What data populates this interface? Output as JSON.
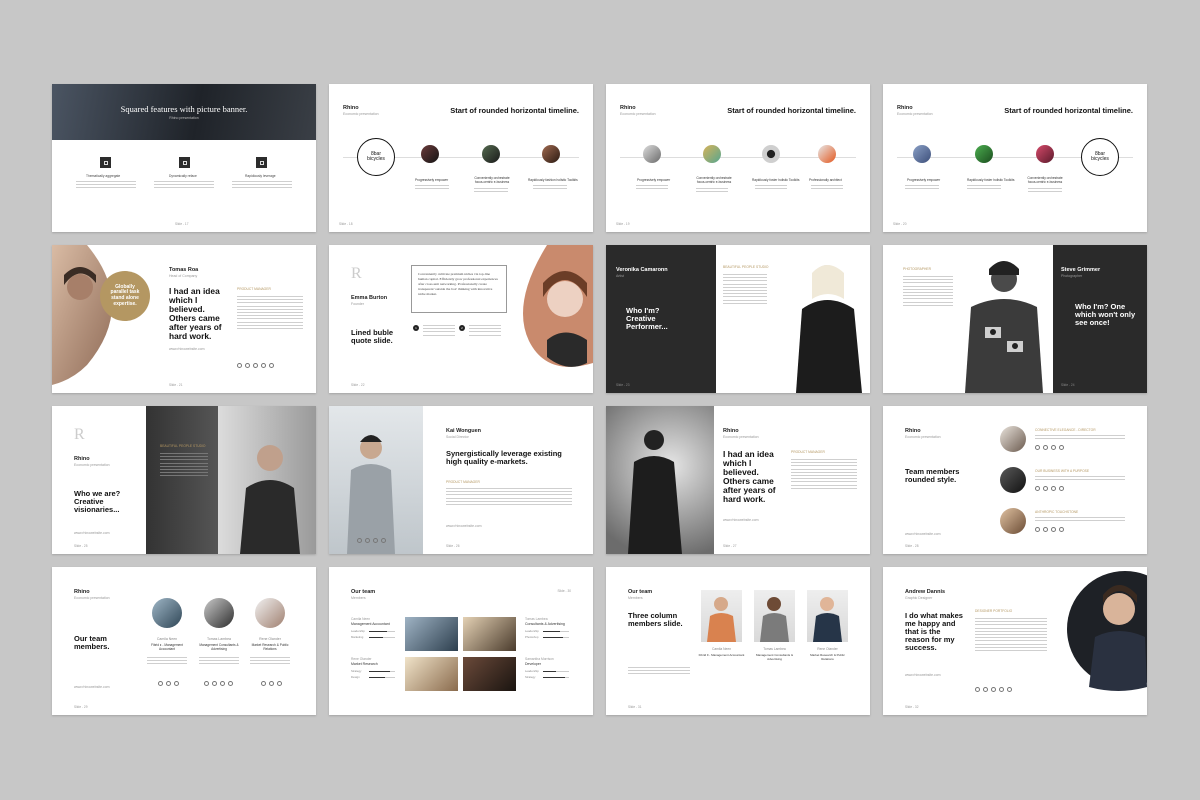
{
  "colors": {
    "accent": "#b49762",
    "dark": "#2a2a2a",
    "background": "#c7c7c7"
  },
  "s1": {
    "title": "Squared features with picture banner.",
    "subtitle": "Rhino presentation",
    "f1": "Thematically aggregate",
    "f2": "Dynamically reface",
    "f3": "Rapidiously leverage",
    "slide": "Slide - 17"
  },
  "s2": {
    "brand": "Rhino",
    "sub": "Economic presentation",
    "title": "Start of rounded horizontal timeline.",
    "ring": "8bar bicycles",
    "l1": "Progressively empower",
    "l2": "Conveniently orchestrate focus-centric e-business",
    "l3": "Rapidiously fashion holistic Toolkits",
    "slide": "Slide - 18"
  },
  "s3": {
    "brand": "Rhino",
    "sub": "Economic presentation",
    "title": "Start of rounded horizontal timeline.",
    "l1": "Progressively empower",
    "l2": "Conveniently orchestrate focus-centric e-business",
    "l3": "Rapidiously foster holistic Toolkits",
    "l4": "Professionally architect",
    "slide": "Slide - 19"
  },
  "s4": {
    "brand": "Rhino",
    "sub": "Economic presentation",
    "title": "Start of rounded horizontal timeline.",
    "ring": "8bar bicycles",
    "l1": "Progressively empower",
    "l2": "Rapidiously foster holistic Toolkits",
    "l3": "Conveniently orchestrate focus-centric e-business",
    "l4": "Progressively empower",
    "slide": "Slide - 20"
  },
  "s5": {
    "name": "Tomas Roa",
    "role": "Head of Company",
    "badge": "Globally parallel task stand alone expertise.",
    "quote": "I had an idea which I believed. Others came after years of hard work.",
    "label": "PRODUCT MANAGER",
    "url": "www.rhinowebsite.com",
    "slide": "Slide - 21"
  },
  "s6": {
    "logo": "R",
    "name": "Emma Burton",
    "role": "Founder",
    "title": "Lined buble quote slide.",
    "bubble": "Conveniently cultivate premium niches via top-line human capital. Efficiently grow professional experiences after cross-unit networking. Professionally create transparent 'outside the box' thinking with innovative niche market.",
    "n1": "1",
    "n2": "2",
    "slide": "Slide - 22"
  },
  "s7": {
    "name": "Veronika Camaronn",
    "role": "Artist",
    "title": "Who I'm? Creative Performer...",
    "label": "BEAUTIFUL PEOPLE STUDIO",
    "slide": "Slide - 23"
  },
  "s8": {
    "label": "PHOTOGRAPHER",
    "name": "Steve Grimmer",
    "role": "Photographer",
    "title": "Who I'm? One which won't only see once!",
    "slide": "Slide - 24"
  },
  "s9": {
    "logo": "R",
    "brand": "Rhino",
    "sub": "Economic presentation",
    "title": "Who we are? Creative visionaries...",
    "label": "BEAUTIFUL PEOPLE STUDIO",
    "url": "www.rhinowebsite.com",
    "slide": "Slide - 25"
  },
  "s10": {
    "name": "Kai Wonguen",
    "role": "Social Director",
    "title": "Synergistically leverage existing high quality e-markets.",
    "label": "PRODUCT MANAGER",
    "url": "www.rhinowebsite.com",
    "slide": "Slide - 26"
  },
  "s11": {
    "brand": "Rhino",
    "sub": "Economic presentation",
    "title": "I had an idea which I believed. Others came after years of hard work.",
    "label": "PRODUCT MANAGER",
    "url": "www.rhinowebsite.com",
    "slide": "Slide - 27"
  },
  "s12": {
    "brand": "Rhino",
    "sub": "Economic presentation",
    "title": "Team members rounded style.",
    "m1": "CONNECTIVE ELEGANCE - DIRECTOR",
    "m2": "OUR BUSINESS WITH A PURPOSE",
    "m3": "ANTHROPIC TOUCHSTONE",
    "url": "www.rhinowebsite.com",
    "slide": "Slide - 28"
  },
  "s13": {
    "brand": "Rhino",
    "sub": "Economic presentation",
    "title": "Our team members.",
    "n1": "Camila Neen",
    "r1": "Fibrid Ⅱ - Management Accountant",
    "n2": "Tomas Lambea",
    "r2": "Management Consultants & Advertising",
    "n3": "Rene Olander",
    "r3": "Market Research & Public Relations",
    "url": "www.rhinowebsite.com",
    "slide": "Slide - 29"
  },
  "s14": {
    "title": "Our team",
    "sub": "Members",
    "slide": "Slide - 30",
    "a1": "Camila Neen",
    "a2": "Management Accountant",
    "a3": "Rene Olander",
    "a4": "Market Research",
    "b1": "Tomas Lambea",
    "b2": "Consultants & Advertising",
    "b3": "Samantha Morrison",
    "b4": "Developer",
    "sk1": "Leadership",
    "sk2": "Marketing",
    "sk3": "Strategy",
    "sk4": "Design",
    "sk5": "Photoshop",
    "sk6": "Leadership"
  },
  "s15": {
    "title": "Our team",
    "sub": "Members",
    "big": "Three column members slide.",
    "n1": "Camila Neen",
    "r1": "Fibrid Ⅱ - Management Accountant",
    "n2": "Tomas Lambea",
    "r2": "Management Consultants & Advertising",
    "n3": "Rene Olander",
    "r3": "Market Research & Public Relations",
    "slide": "Slide - 31"
  },
  "s16": {
    "name": "Andrew Dannis",
    "role": "Graphic Designer",
    "quote": "I do what makes me happy and that is the reason for my success.",
    "label": "DESIGNER PORTFOLIO",
    "url": "www.rhinowebsite.com",
    "slide": "Slide - 32"
  }
}
